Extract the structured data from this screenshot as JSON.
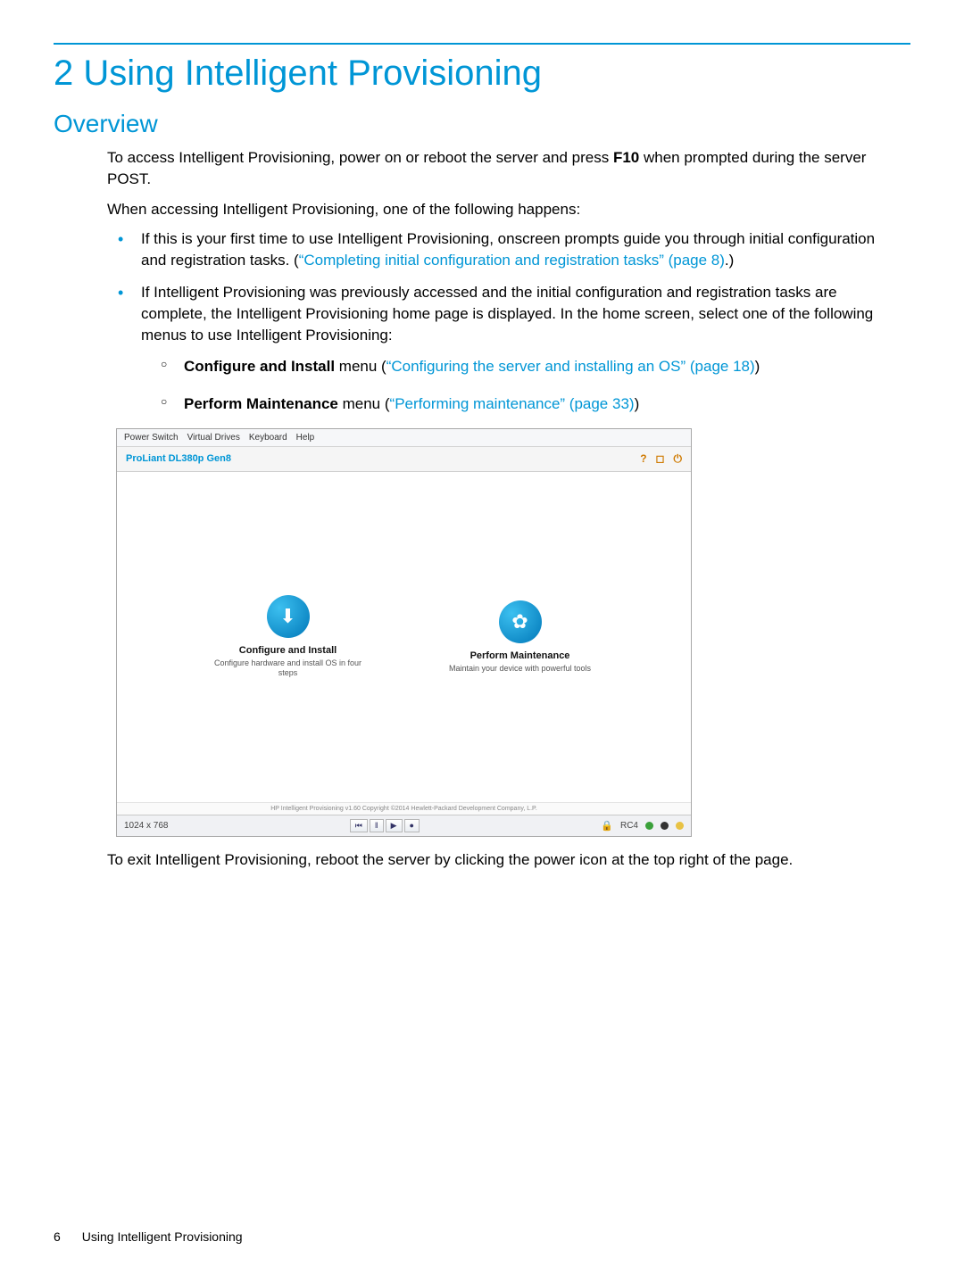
{
  "chapter_title": "2 Using Intelligent Provisioning",
  "section_title": "Overview",
  "intro": {
    "p1_pre": "To access Intelligent Provisioning, power on or reboot the server and press ",
    "p1_key": "F10",
    "p1_post": " when prompted during the server POST.",
    "p2": "When accessing Intelligent Provisioning, one of the following happens:"
  },
  "bullets": {
    "b1_pre": "If this is your first time to use Intelligent Provisioning, onscreen prompts guide you through initial configuration and registration tasks. (",
    "b1_xref": "“Completing initial configuration and registration tasks” (page 8)",
    "b1_post": ".)",
    "b2": "If Intelligent Provisioning was previously accessed and the initial configuration and registration tasks are complete, the Intelligent Provisioning home page is displayed. In the home screen, select one of the following menus to use Intelligent Provisioning:"
  },
  "subbullets": {
    "s1_bold": "Configure and Install",
    "s1_mid": " menu (",
    "s1_xref": "“Configuring the server and installing an OS” (page 18)",
    "s1_post": ")",
    "s2_bold": "Perform Maintenance",
    "s2_mid": " menu (",
    "s2_xref": "“Performing maintenance” (page 33)",
    "s2_post": ")"
  },
  "screenshot": {
    "menubar": {
      "m1": "Power Switch",
      "m2": "Virtual Drives",
      "m3": "Keyboard",
      "m4": "Help"
    },
    "title": "ProLiant DL380p Gen8",
    "title_icons": {
      "help": "?",
      "home": "◻",
      "power": "⏻"
    },
    "cards": {
      "left": {
        "icon": "⬇",
        "title": "Configure and Install",
        "sub": "Configure hardware and install OS in four steps"
      },
      "right": {
        "icon": "✿",
        "title": "Perform Maintenance",
        "sub": "Maintain your device with powerful tools"
      }
    },
    "copyright": "HP Intelligent Provisioning v1.60 Copyright ©2014 Hewlett-Packard Development Company, L.P.",
    "status": {
      "res": "1024 x 768",
      "btns": {
        "b1": "⏮",
        "b2": "‖",
        "b3": "▶",
        "b4": "●"
      },
      "enc": "RC4"
    }
  },
  "exit_text": "To exit Intelligent Provisioning, reboot the server by clicking the power icon at the top right of the page.",
  "footer": {
    "page_no": "6",
    "running": "Using Intelligent Provisioning"
  }
}
